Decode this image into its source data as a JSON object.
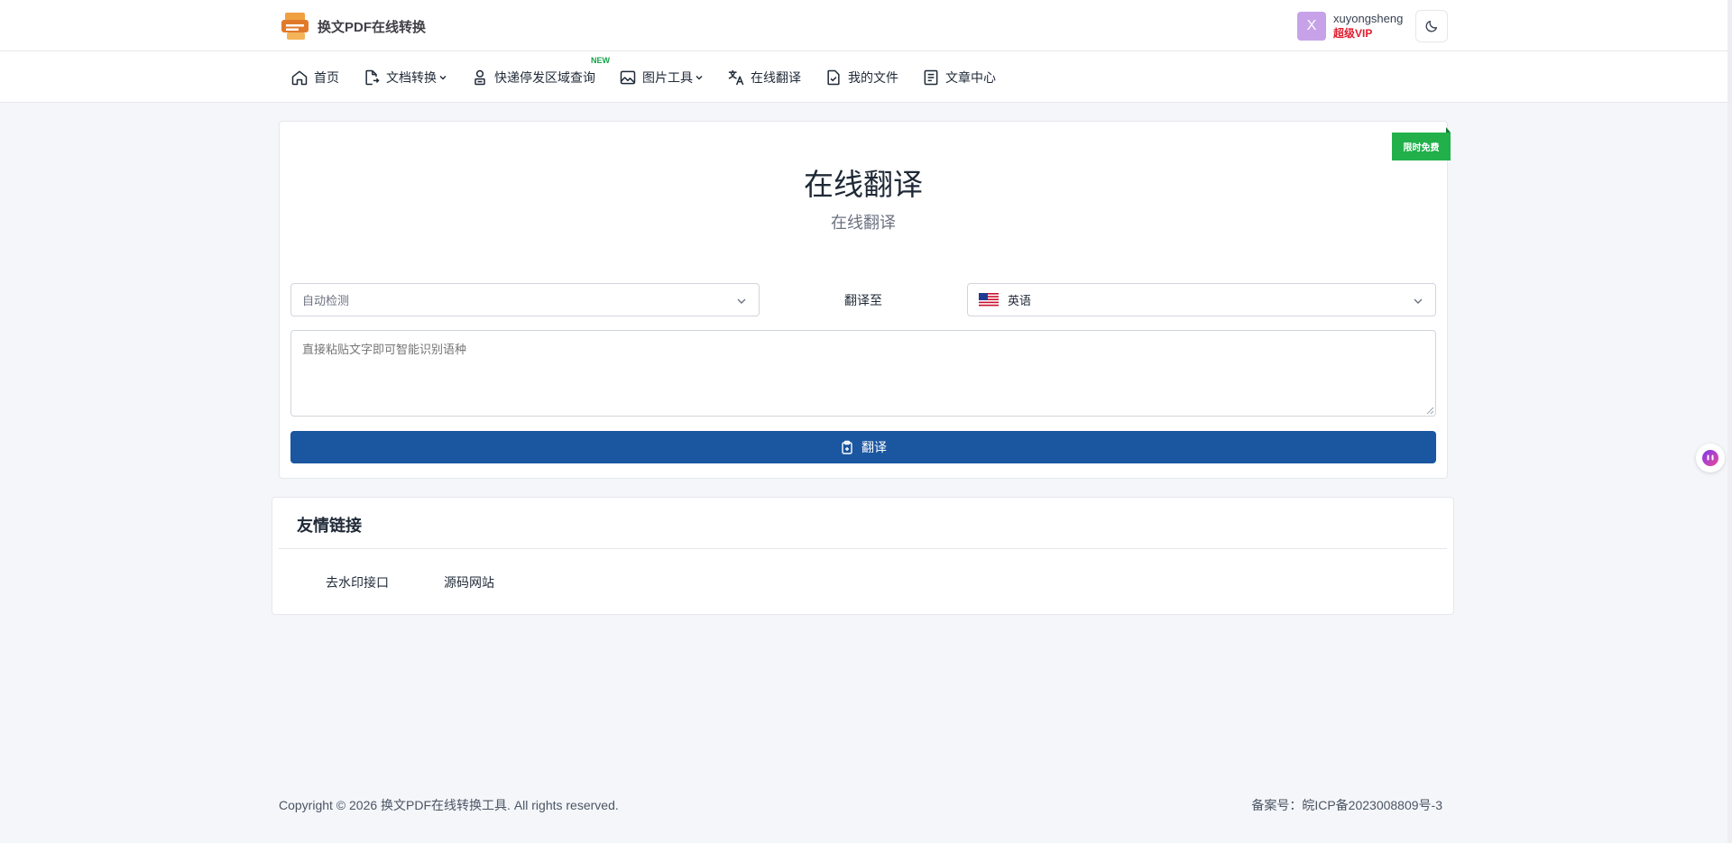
{
  "header": {
    "brand_name": "换文PDF在线转换",
    "user": {
      "avatar_letter": "X",
      "username": "xuyongsheng",
      "vip_label": "超级VIP"
    },
    "theme_toggle_icon": "moon-icon"
  },
  "nav": {
    "items": [
      {
        "label": "首页",
        "icon": "home-icon"
      },
      {
        "label": "文档转换",
        "icon": "file-convert-icon",
        "dropdown": true
      },
      {
        "label": "快递停发区域查询",
        "icon": "user-package-icon",
        "badge": "NEW"
      },
      {
        "label": "图片工具",
        "icon": "image-icon",
        "dropdown": true
      },
      {
        "label": "在线翻译",
        "icon": "translate-icon"
      },
      {
        "label": "我的文件",
        "icon": "file-check-icon"
      },
      {
        "label": "文章中心",
        "icon": "article-icon"
      }
    ]
  },
  "translator": {
    "ribbon": "限时免费",
    "title": "在线翻译",
    "subtitle": "在线翻译",
    "source_language": "自动检测",
    "to_label": "翻译至",
    "target_language": "英语",
    "input_placeholder": "直接粘贴文字即可智能识别语种",
    "button_label": "翻译"
  },
  "links": {
    "title": "友情链接",
    "items": [
      "去水印接口",
      "源码网站"
    ]
  },
  "footer": {
    "copyright": "Copyright © 2026 换文PDF在线转换工具. All rights reserved.",
    "icp": "备案号：皖ICP备2023008809号-3"
  },
  "colors": {
    "primary": "#1b56a0",
    "ribbon": "#22b04b",
    "vip": "#e11d2e",
    "background": "#f4f6fa"
  }
}
